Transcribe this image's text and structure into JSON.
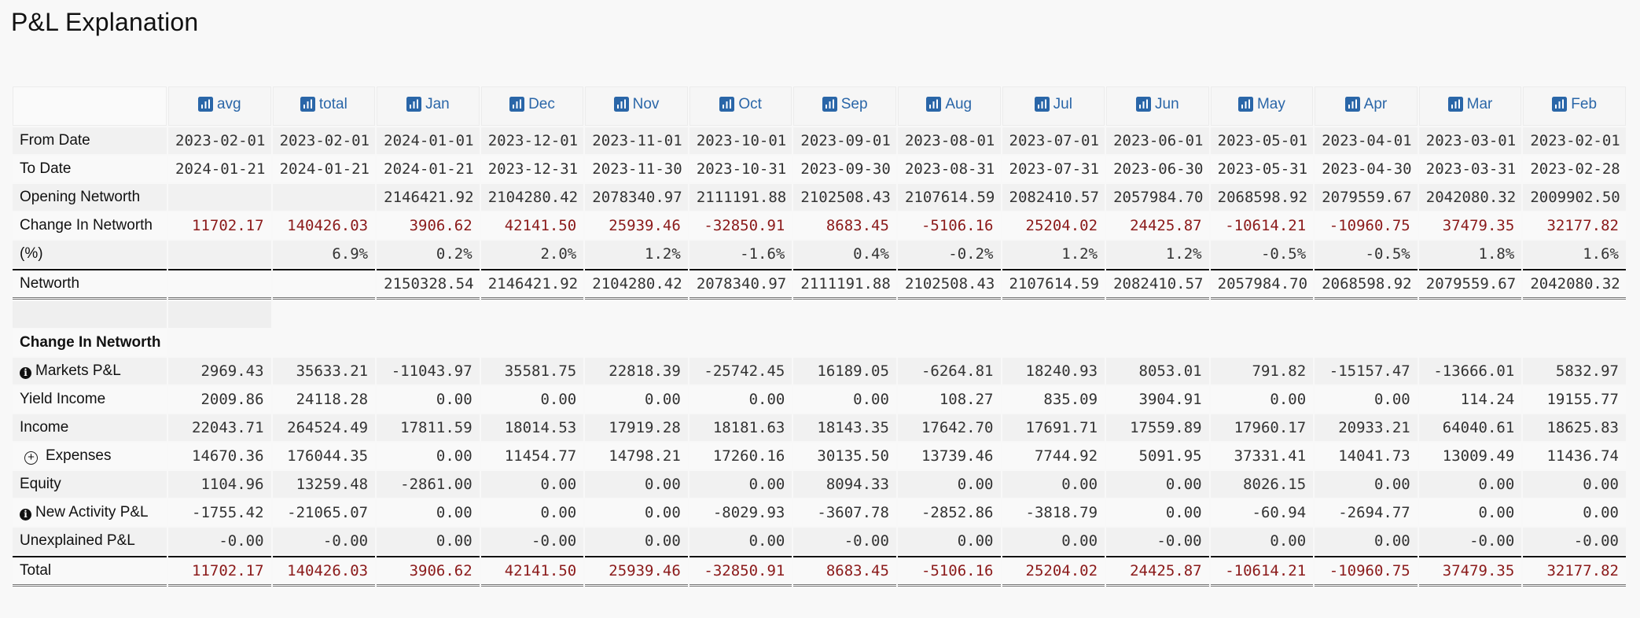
{
  "page": {
    "title": "P&L Explanation"
  },
  "icon_names": {
    "column_header": "bar-chart-icon",
    "info": "info-icon",
    "expand": "plus-circle-icon"
  },
  "colors": {
    "header_link": "#2a66a8",
    "negative_value": "#8b1a1a"
  },
  "columns": [
    "avg",
    "total",
    "Jan",
    "Dec",
    "Nov",
    "Oct",
    "Sep",
    "Aug",
    "Jul",
    "Jun",
    "May",
    "Apr",
    "Mar",
    "Feb"
  ],
  "summary_rows": [
    {
      "label": "From Date",
      "values": [
        "2023-02-01",
        "2023-02-01",
        "2024-01-01",
        "2023-12-01",
        "2023-11-01",
        "2023-10-01",
        "2023-09-01",
        "2023-08-01",
        "2023-07-01",
        "2023-06-01",
        "2023-05-01",
        "2023-04-01",
        "2023-03-01",
        "2023-02-01"
      ]
    },
    {
      "label": "To Date",
      "values": [
        "2024-01-21",
        "2024-01-21",
        "2024-01-21",
        "2023-12-31",
        "2023-11-30",
        "2023-10-31",
        "2023-09-30",
        "2023-08-31",
        "2023-07-31",
        "2023-06-30",
        "2023-05-31",
        "2023-04-30",
        "2023-03-31",
        "2023-02-28"
      ]
    },
    {
      "label": "Opening Networth",
      "values": [
        "",
        "",
        "2146421.92",
        "2104280.42",
        "2078340.97",
        "2111191.88",
        "2102508.43",
        "2107614.59",
        "2082410.57",
        "2057984.70",
        "2068598.92",
        "2079559.67",
        "2042080.32",
        "2009902.50"
      ]
    },
    {
      "label": "Change In Networth",
      "red": true,
      "values": [
        "11702.17",
        "140426.03",
        "3906.62",
        "42141.50",
        "25939.46",
        "-32850.91",
        "8683.45",
        "-5106.16",
        "25204.02",
        "24425.87",
        "-10614.21",
        "-10960.75",
        "37479.35",
        "32177.82"
      ]
    },
    {
      "label": "(%)",
      "values": [
        "",
        "6.9%",
        "0.2%",
        "2.0%",
        "1.2%",
        "-1.6%",
        "0.4%",
        "-0.2%",
        "1.2%",
        "1.2%",
        "-0.5%",
        "-0.5%",
        "1.8%",
        "1.6%"
      ]
    }
  ],
  "networth_row": {
    "label": "Networth",
    "values": [
      "",
      "",
      "2150328.54",
      "2146421.92",
      "2104280.42",
      "2078340.97",
      "2111191.88",
      "2102508.43",
      "2107614.59",
      "2082410.57",
      "2057984.70",
      "2068598.92",
      "2079559.67",
      "2042080.32"
    ]
  },
  "section_title": "Change In Networth",
  "detail_rows": [
    {
      "label": "Markets P&L",
      "icon": "info",
      "values": [
        "2969.43",
        "35633.21",
        "-11043.97",
        "35581.75",
        "22818.39",
        "-25742.45",
        "16189.05",
        "-6264.81",
        "18240.93",
        "8053.01",
        "791.82",
        "-15157.47",
        "-13666.01",
        "5832.97"
      ]
    },
    {
      "label": "Yield Income",
      "values": [
        "2009.86",
        "24118.28",
        "0.00",
        "0.00",
        "0.00",
        "0.00",
        "0.00",
        "108.27",
        "835.09",
        "3904.91",
        "0.00",
        "0.00",
        "114.24",
        "19155.77"
      ]
    },
    {
      "label": "Income",
      "values": [
        "22043.71",
        "264524.49",
        "17811.59",
        "18014.53",
        "17919.28",
        "18181.63",
        "18143.35",
        "17642.70",
        "17691.71",
        "17559.89",
        "17960.17",
        "20933.21",
        "64040.61",
        "18625.83"
      ]
    },
    {
      "label": "Expenses",
      "icon": "expand",
      "values": [
        "14670.36",
        "176044.35",
        "0.00",
        "11454.77",
        "14798.21",
        "17260.16",
        "30135.50",
        "13739.46",
        "7744.92",
        "5091.95",
        "37331.41",
        "14041.73",
        "13009.49",
        "11436.74"
      ]
    },
    {
      "label": "Equity",
      "values": [
        "1104.96",
        "13259.48",
        "-2861.00",
        "0.00",
        "0.00",
        "0.00",
        "8094.33",
        "0.00",
        "0.00",
        "0.00",
        "8026.15",
        "0.00",
        "0.00",
        "0.00"
      ]
    },
    {
      "label": "New Activity P&L",
      "icon": "info",
      "values": [
        "-1755.42",
        "-21065.07",
        "0.00",
        "0.00",
        "0.00",
        "-8029.93",
        "-3607.78",
        "-2852.86",
        "-3818.79",
        "0.00",
        "-60.94",
        "-2694.77",
        "0.00",
        "0.00"
      ]
    },
    {
      "label": "Unexplained P&L",
      "values": [
        "-0.00",
        "-0.00",
        "0.00",
        "-0.00",
        "0.00",
        "0.00",
        "-0.00",
        "0.00",
        "0.00",
        "-0.00",
        "0.00",
        "0.00",
        "-0.00",
        "-0.00"
      ]
    }
  ],
  "total_row": {
    "label": "Total",
    "red": true,
    "values": [
      "11702.17",
      "140426.03",
      "3906.62",
      "42141.50",
      "25939.46",
      "-32850.91",
      "8683.45",
      "-5106.16",
      "25204.02",
      "24425.87",
      "-10614.21",
      "-10960.75",
      "37479.35",
      "32177.82"
    ]
  }
}
